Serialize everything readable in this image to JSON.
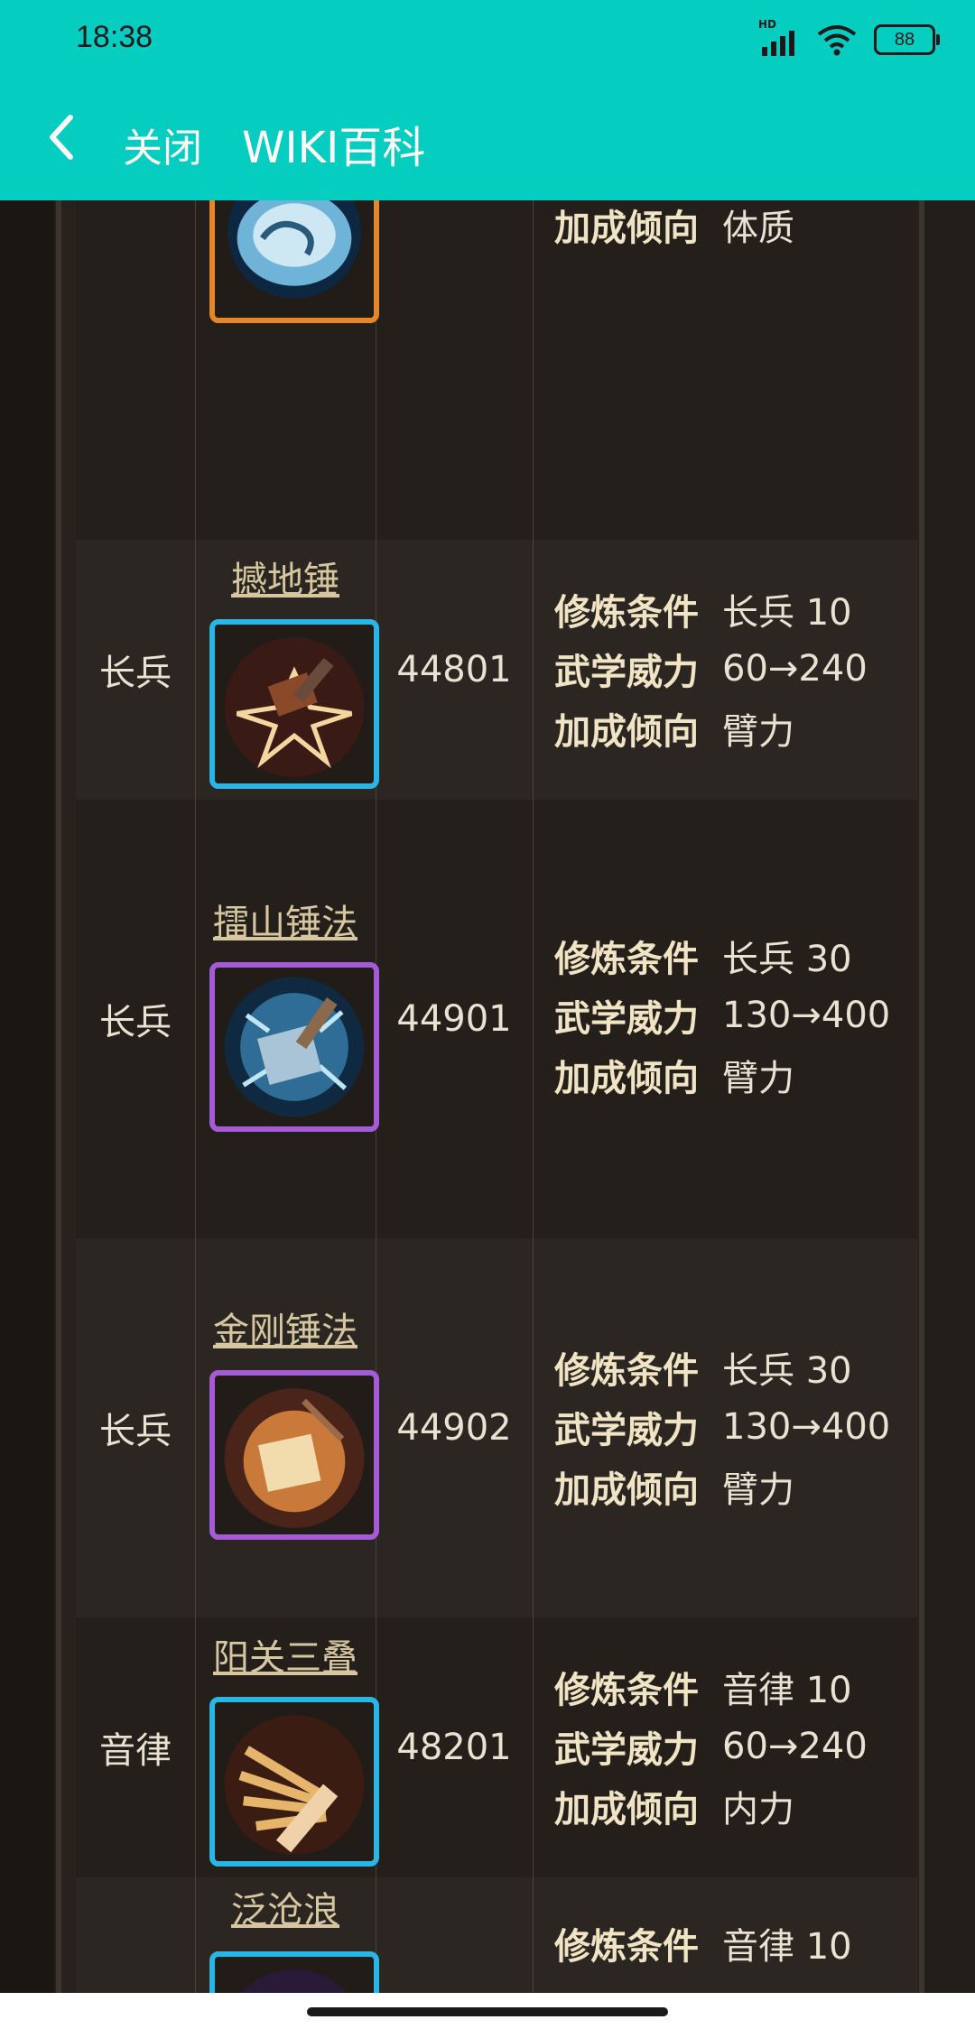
{
  "status": {
    "time": "18:38",
    "hd": "HD",
    "battery": "88"
  },
  "appbar": {
    "close": "关闭",
    "title": "WIKI百科"
  },
  "labels": {
    "cond": "修炼条件",
    "power": "武学威力",
    "tendency": "加成倾向"
  },
  "colors": {
    "accent": "#05cdbf",
    "border_blue": "#29b6e6",
    "border_purple": "#a55bd6",
    "border_orange": "#e6862b"
  },
  "rows": [
    {
      "type": "",
      "name": "",
      "id": "",
      "cond": "",
      "power": "",
      "tendency": "体质",
      "icon": "blue-fist-icon",
      "border": "#e6862b"
    },
    {
      "type": "长兵",
      "name": "撼地锤",
      "id": "44801",
      "cond": "长兵 10",
      "power": "60→240",
      "tendency": "臂力",
      "icon": "ground-hammer-icon",
      "border": "#29b6e6"
    },
    {
      "type": "长兵",
      "name": "擂山锤法",
      "id": "44901",
      "cond": "长兵 30",
      "power": "130→400",
      "tendency": "臂力",
      "icon": "ice-hammer-icon",
      "border": "#a55bd6"
    },
    {
      "type": "长兵",
      "name": "金刚锤法",
      "id": "44902",
      "cond": "长兵 30",
      "power": "130→400",
      "tendency": "臂力",
      "icon": "golden-hammer-icon",
      "border": "#a55bd6"
    },
    {
      "type": "音律",
      "name": "阳关三叠",
      "id": "48201",
      "cond": "音律 10",
      "power": "60→240",
      "tendency": "内力",
      "icon": "fan-flute-icon",
      "border": "#29b6e6"
    },
    {
      "type": "",
      "name": "泛沧浪",
      "id": "",
      "cond": "音律 10",
      "power": "",
      "tendency": "",
      "icon": "purple-wave-icon",
      "border": "#29b6e6"
    }
  ]
}
